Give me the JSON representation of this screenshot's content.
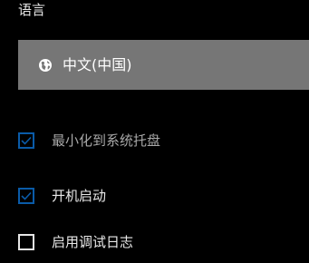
{
  "language": {
    "section_label": "语言",
    "selected_value": "中文(中国)",
    "icon": "globe-icon",
    "background": "#767676"
  },
  "options": [
    {
      "label": "最小化到系统托盘",
      "checked": true
    },
    {
      "label": "开机启动",
      "checked": true
    },
    {
      "label": "启用调试日志",
      "checked": false
    }
  ],
  "colors": {
    "accent": "#0a5ba8",
    "background": "#000000"
  }
}
